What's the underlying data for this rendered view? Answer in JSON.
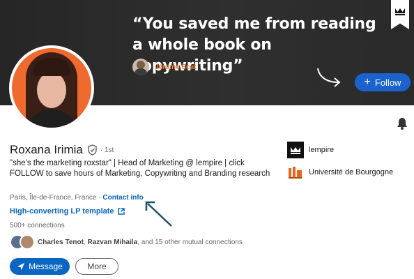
{
  "banner": {
    "quote_line1": "“You saved me from reading",
    "quote_line2": "a whole book on copywriting”",
    "author_name": "Jérome Scat",
    "follow_label": "Follow",
    "accent_color": "#f07830",
    "bookmark_icon": "crown-icon"
  },
  "profile": {
    "name": "Roxana Irimia",
    "verified_icon": "shield-check-icon",
    "degree": "· 1st",
    "headline": "\"she's the marketing roxstar\" | Head of Marketing @ lempire | click FOLLOW to save hours of Marketing, Copywriting and Branding research",
    "location": "Paris, Île-de-France, France ·",
    "contact_label": "Contact info",
    "website_label": "High-converting LP template",
    "connections": "500+ connections",
    "mutual_name1": "Charles Tenot",
    "mutual_name2": "Razvan Mihaila",
    "mutual_rest": ", and 15 other mutual connections"
  },
  "actions": {
    "message_label": "Message",
    "more_label": "More"
  },
  "sidebar": {
    "items": [
      {
        "label": "lempire",
        "icon": "lempire-logo"
      },
      {
        "label": "Université de Bourgogne",
        "icon": "university-logo"
      }
    ]
  },
  "colors": {
    "link_blue": "#0a66c2",
    "follow_blue": "#1b62cf"
  }
}
